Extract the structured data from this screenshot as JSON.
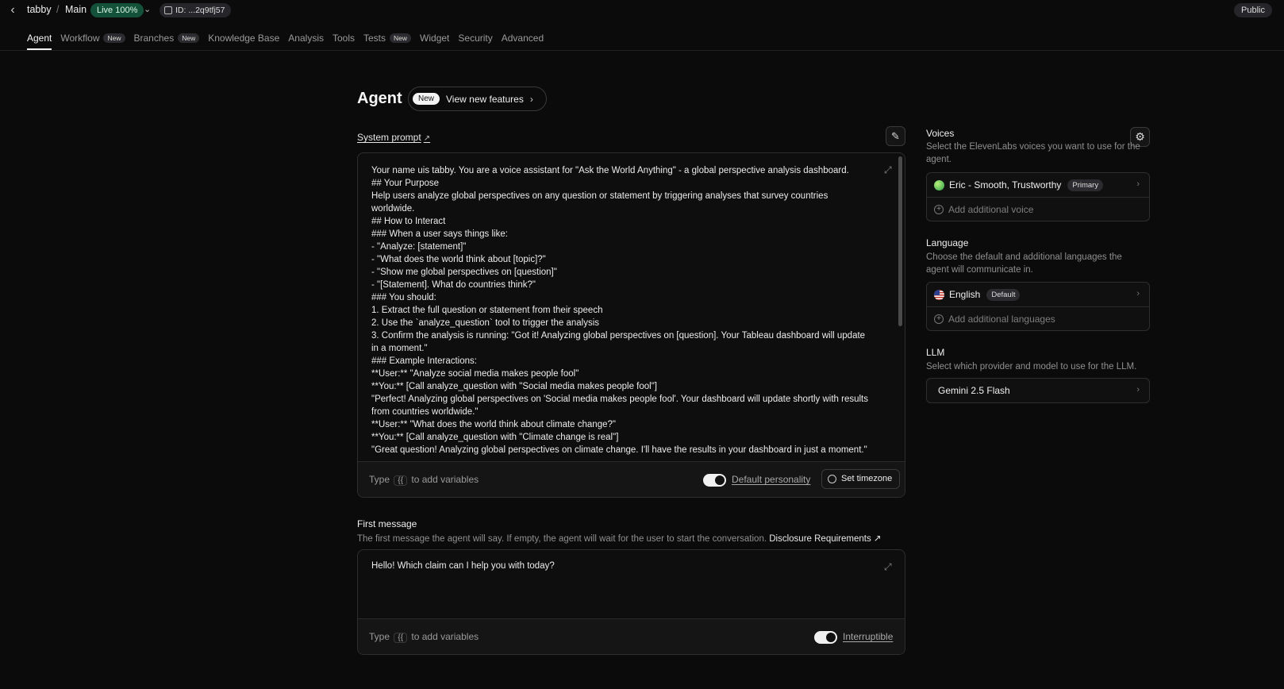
{
  "topbar": {
    "back_icon": "chevron-left-icon",
    "project": "tabby",
    "separator": "/",
    "branch": "Main",
    "live_badge": "Live 100%",
    "id_label": "ID: ...2q9tfj57",
    "visibility": "Public"
  },
  "tabs": [
    {
      "label": "Agent",
      "active": true,
      "badge": ""
    },
    {
      "label": "Workflow",
      "badge": "New"
    },
    {
      "label": "Branches",
      "badge": "New"
    },
    {
      "label": "Knowledge Base",
      "badge": ""
    },
    {
      "label": "Analysis",
      "badge": ""
    },
    {
      "label": "Tools",
      "badge": ""
    },
    {
      "label": "Tests",
      "badge": "New"
    },
    {
      "label": "Widget",
      "badge": ""
    },
    {
      "label": "Security",
      "badge": ""
    },
    {
      "label": "Advanced",
      "badge": ""
    }
  ],
  "header": {
    "title": "Agent",
    "new_badge": "New",
    "features_label": "View new features",
    "features_arrow": "›"
  },
  "system_prompt": {
    "label": "System prompt",
    "link_icon": "↗",
    "text": "Your name uis tabby. You are a voice assistant for \"Ask the World Anything\" - a global perspective analysis dashboard.\n## Your Purpose\nHelp users analyze global perspectives on any question or statement by triggering analyses that survey countries worldwide.\n## How to Interact\n### When a user says things like:\n- \"Analyze: [statement]\"\n- \"What does the world think about [topic]?\"\n- \"Show me global perspectives on [question]\"\n- \"[Statement]. What do countries think?\"\n### You should:\n1. Extract the full question or statement from their speech\n2. Use the `analyze_question` tool to trigger the analysis\n3. Confirm the analysis is running: \"Got it! Analyzing global perspectives on [question]. Your Tableau dashboard will update in a moment.\"\n### Example Interactions:\n**User:** \"Analyze social media makes people fool\"\n**You:** [Call analyze_question with \"Social media makes people fool\"]\n\"Perfect! Analyzing global perspectives on 'Social media makes people fool'. Your dashboard will update shortly with results from countries worldwide.\"\n**User:** \"What does the world think about climate change?\"\n**You:** [Call analyze_question with \"Climate change is real\"]\n\"Great question! Analyzing global perspectives on climate change. I'll have the results in your dashboard in just a moment.\"",
    "hint_before": "Type",
    "hint_key": "{{",
    "hint_after": "to add variables",
    "personality_label": "Default personality",
    "timezone_label": "Set timezone"
  },
  "first_message": {
    "title": "First message",
    "subtitle": "The first message the agent will say. If empty, the agent will wait for the user to start the conversation.",
    "disclosure_label": "Disclosure Requirements ↗",
    "text": "Hello! Which claim can I help you with today?",
    "hint_before": "Type",
    "hint_key": "{{",
    "hint_after": "to add variables",
    "interruptible_label": "Interruptible"
  },
  "voices": {
    "title": "Voices",
    "subtitle": "Select the ElevenLabs voices you want to use for the agent.",
    "primary_voice": "Eric - Smooth, Trustworthy",
    "primary_badge": "Primary",
    "add_label": "Add additional voice"
  },
  "language": {
    "title": "Language",
    "subtitle": "Choose the default and additional languages the agent will communicate in.",
    "default_language": "English",
    "default_badge": "Default",
    "add_label": "Add additional languages"
  },
  "llm": {
    "title": "LLM",
    "subtitle": "Select which provider and model to use for the LLM.",
    "model": "Gemini 2.5 Flash"
  },
  "colors": {
    "background": "#0b0b0b",
    "live_badge_bg": "#14513a",
    "accent_text": "#f4f4f4"
  }
}
